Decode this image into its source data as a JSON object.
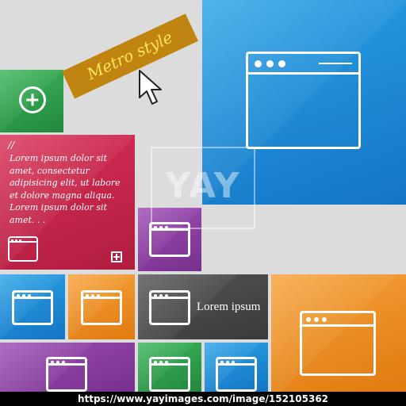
{
  "banner": {
    "text": "Metro style"
  },
  "text_tile": {
    "quote_mark": "//",
    "body": "Lorem ipsum dolor sit amet, consectetur adipisicing elit, ut labore et dolore magna aliqua. Lorem ipsum dolor sit amet. . ."
  },
  "caption_tile": {
    "text": "Lorem ipsum"
  },
  "watermark": {
    "text": "YAY"
  },
  "footer": {
    "text": "https://www.yayimages.com/image/152105362"
  },
  "colors": {
    "blue": "#1e90d8",
    "green": "#2e9f4a",
    "crimson": "#c9234b",
    "purple": "#8a3fa0",
    "orange": "#ef8c1e",
    "dark": "#444444",
    "banner": "#c08410"
  },
  "icons": [
    "plus-circle-icon",
    "browser-window-icon",
    "cursor-arrow-icon",
    "small-plus-icon"
  ]
}
